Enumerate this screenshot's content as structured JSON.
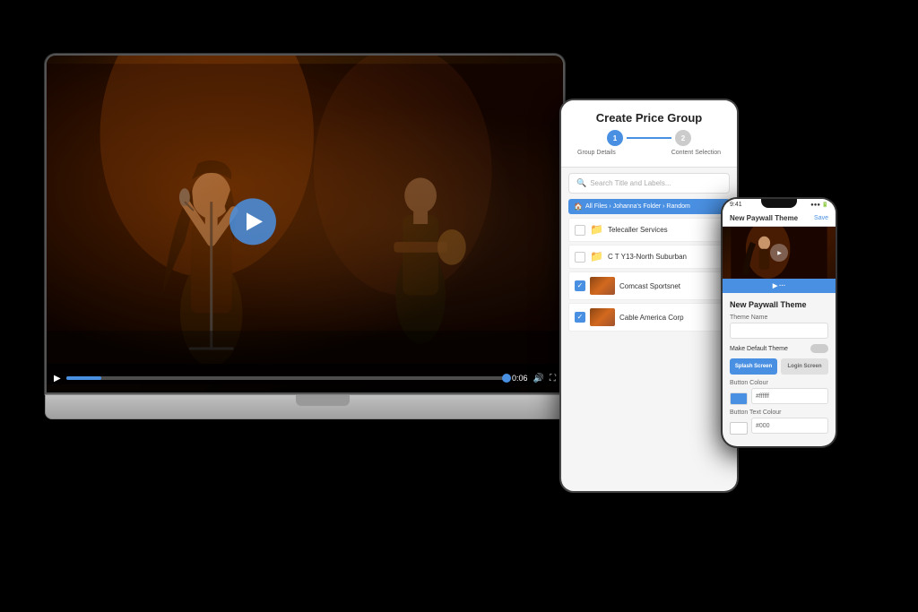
{
  "scene": {
    "background": "#000000"
  },
  "laptop": {
    "video": {
      "time": "0:06",
      "play_button_aria": "Play"
    }
  },
  "tablet": {
    "title": "Create Price Group",
    "stepper": {
      "step1": "1",
      "step2": "2",
      "label1": "Group Details",
      "label2": "Content Selection"
    },
    "search_placeholder": "Search Title and Labels...",
    "breadcrumb": "All Files › Johanna's Folder › Random",
    "items": [
      {
        "label": "Telecaller Services",
        "type": "folder",
        "checked": false
      },
      {
        "label": "C T Y13-North Suburban",
        "type": "folder",
        "checked": false
      },
      {
        "label": "Comcast Sportsnet",
        "type": "video",
        "checked": true
      },
      {
        "label": "Cable America Corp",
        "type": "video",
        "checked": true
      }
    ]
  },
  "phone": {
    "time": "9:41",
    "header_text": "New Paywall Theme",
    "header_action": "Save",
    "section_title": "New Paywall Theme",
    "theme_name_label": "Theme Name",
    "theme_name_value": "",
    "make_default_label": "Make Default Theme",
    "tab1": "Splash Screen",
    "tab2": "Login Screen",
    "button_color_label": "Button Colour",
    "button_color_value": "#ffffff",
    "button_text_label": "Button Text Colour",
    "button_text_value": "#000"
  }
}
